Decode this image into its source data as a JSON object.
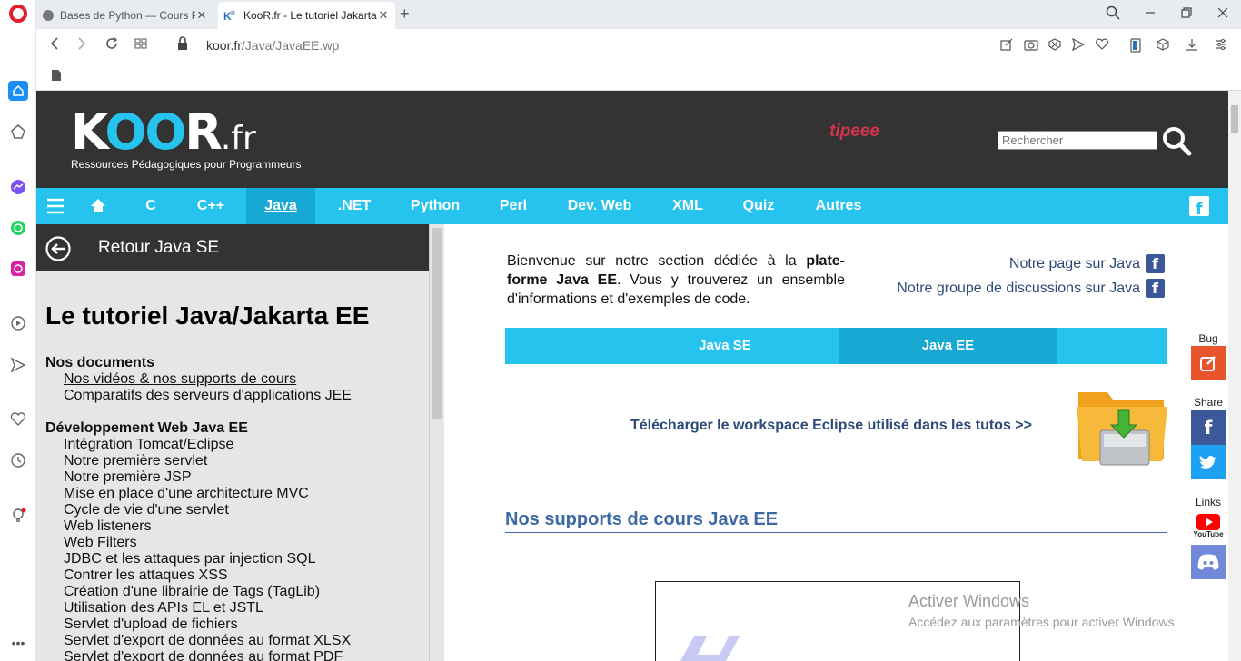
{
  "browser": {
    "tabs": [
      {
        "title": "Bases de Python — Cours Python",
        "close": "✕"
      },
      {
        "title": "KooR.fr - Le tutoriel Jakarta EE",
        "close": "✕"
      }
    ],
    "new_tab": "+",
    "url_host": "koor.fr",
    "url_path": "/Java/JavaEE.wp"
  },
  "site": {
    "logo_main": "K",
    "logo_oo": "OO",
    "logo_r": "R",
    "logo_fr": ".fr",
    "tagline": "Ressources Pédagogiques pour Programmeurs",
    "tipeee": "tipeee",
    "search_placeholder": "Rechercher",
    "nav": [
      {
        "label": "C"
      },
      {
        "label": "C++"
      },
      {
        "label": "Java"
      },
      {
        "label": ".NET"
      },
      {
        "label": "Python"
      },
      {
        "label": "Perl"
      },
      {
        "label": "Dev. Web"
      },
      {
        "label": "XML"
      },
      {
        "label": "Quiz"
      },
      {
        "label": "Autres"
      }
    ]
  },
  "left_panel": {
    "back_label": "Retour Java SE",
    "title": "Le tutoriel Java/Jakarta EE",
    "groups": [
      {
        "heading": "Nos documents",
        "links": [
          "Nos vidéos & nos supports de cours",
          "Comparatifs des serveurs d'applications JEE"
        ]
      },
      {
        "heading": "Développement Web Java EE",
        "links": [
          "Intégration Tomcat/Eclipse",
          "Notre première servlet",
          "Notre première JSP",
          "Mise en place d'une architecture MVC",
          "Cycle de vie d'une servlet",
          "Web listeners",
          "Web Filters",
          "JDBC et les attaques par injection SQL",
          "Contrer les attaques XSS",
          "Création d'une librairie de Tags (TagLib)",
          "Utilisation des APIs EL et JSTL",
          "Servlet d'upload de fichiers",
          "Servlet d'export de données au format XLSX",
          "Servlet d'export de données au format PDF"
        ]
      }
    ]
  },
  "main": {
    "intro_part1": "Bienvenue sur notre section dédiée à la ",
    "intro_bold": "plate-forme Java EE",
    "intro_part2": ". Vous y trouverez un ensemble d'informations et d'exemples de code.",
    "fb_page": "Notre page sur Java",
    "fb_group": "Notre groupe de discussions sur Java",
    "fb_letter": "f",
    "subnav": [
      {
        "label": "Java SE"
      },
      {
        "label": "Java EE"
      }
    ],
    "download": "Télécharger le workspace Eclipse utilisé dans les tutos >>",
    "section_title": "Nos supports de cours Java EE",
    "side": {
      "bug": "Bug",
      "share": "Share",
      "links": "Links",
      "youtube": "YouTube"
    }
  },
  "windows_watermark": {
    "line1": "Activer Windows",
    "line2": "Accédez aux paramètres pour activer Windows."
  },
  "colors": {
    "accent": "#25c3ee",
    "header": "#333333",
    "link": "#2b4a7a"
  }
}
